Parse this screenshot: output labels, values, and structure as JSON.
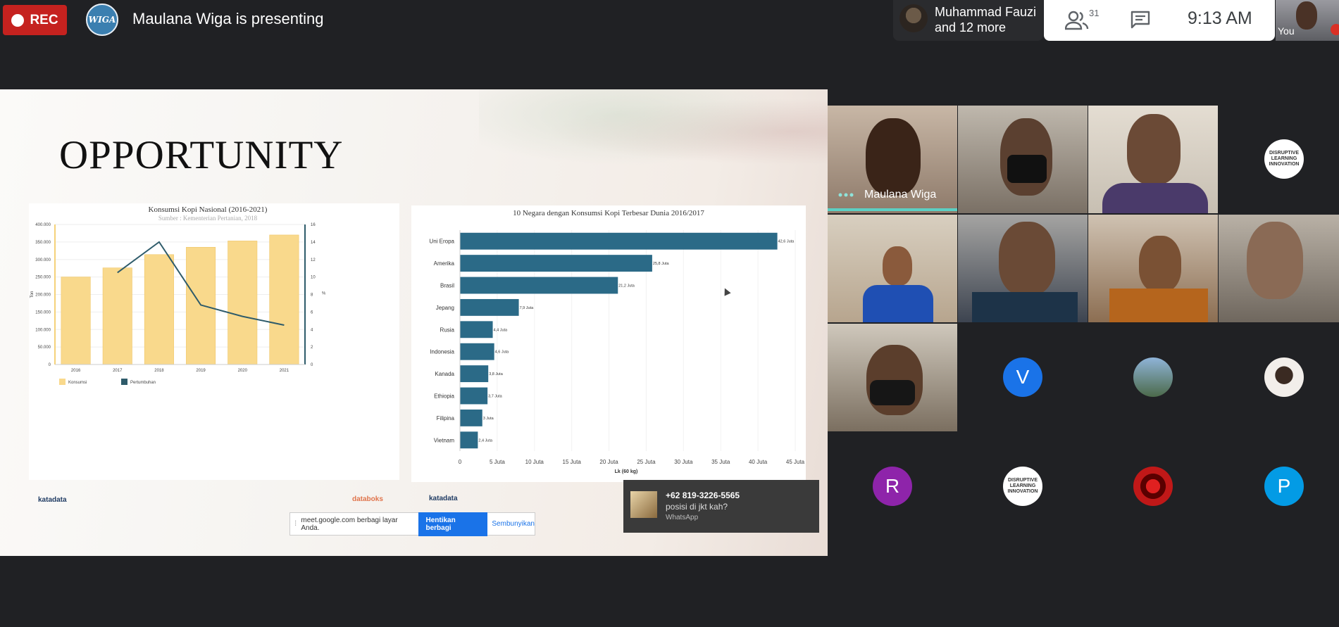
{
  "top_bar": {
    "rec_label": "REC",
    "presenter_avatar_text": "WIGA",
    "presenting_text": "Maulana Wiga is presenting",
    "joined_line1": "Muhammad Fauzi",
    "joined_line2": "and 12 more",
    "participant_count": "31",
    "time": "9:13  AM",
    "self_label": "You"
  },
  "slide": {
    "title": "OPPORTUNITY",
    "logos": [
      "katadata",
      "databoks",
      "katadata"
    ]
  },
  "chart_data": [
    {
      "type": "bar",
      "title": "Konsumsi Kopi Nasional (2016-2021)",
      "subtitle": "Sumber : Kementerian Pertanian, 2018",
      "categories": [
        "2016",
        "2017",
        "2018",
        "2019",
        "2020",
        "2021"
      ],
      "ylabel": "Ton",
      "ylabel_right": "%",
      "ylim": [
        0,
        400000
      ],
      "ylim_right": [
        0,
        16
      ],
      "y_ticks": [
        "0",
        "50.000",
        "100.000",
        "150.000",
        "200.000",
        "250.000",
        "300.000",
        "350.000",
        "400.000"
      ],
      "y_ticks_right": [
        "0",
        "2",
        "4",
        "6",
        "8",
        "10",
        "12",
        "14",
        "16"
      ],
      "series": [
        {
          "name": "Konsumsi",
          "type": "bar",
          "color": "#f9d98c",
          "values": [
            250000,
            276000,
            314000,
            335000,
            353000,
            370000
          ]
        },
        {
          "name": "Pertumbuhan",
          "type": "line",
          "color": "#2e5b6a",
          "values": [
            null,
            10.5,
            14,
            6.8,
            5.5,
            4.5
          ]
        }
      ],
      "legend_position": "bottom-left"
    },
    {
      "type": "bar",
      "orientation": "horizontal",
      "title": "10 Negara dengan Konsumsi Kopi Terbesar Dunia 2016/2017",
      "categories": [
        "Uni Eropa",
        "Amerika",
        "Brasil",
        "Jepang",
        "Rusia",
        "Indonesia",
        "Kanada",
        "Ethiopia",
        "Filipina",
        "Vietnam"
      ],
      "values": [
        42.6,
        25.8,
        21.2,
        7.9,
        4.4,
        4.6,
        3.8,
        3.7,
        3,
        2.4
      ],
      "value_labels": [
        "42,6 Juta",
        "25,8 Juta",
        "21,2 Juta",
        "7,9 Juta",
        "4,4 Juta",
        "4,6 Juta",
        "3,8 Juta",
        "3,7 Juta",
        "3 Juta",
        "2,4 Juta"
      ],
      "x_ticks": [
        "0",
        "5 Juta",
        "10 Juta",
        "15 Juta",
        "20 Juta",
        "25 Juta",
        "30 Juta",
        "35 Juta",
        "40 Juta",
        "45 Juta"
      ],
      "xlim": [
        0,
        45
      ],
      "xlabel": "Lk (60 kg)",
      "color": "#2b6a87"
    }
  ],
  "share_bar": {
    "message": "meet.google.com berbagi layar Anda.",
    "stop_label": "Hentikan berbagi",
    "hide_label": "Sembunyikan"
  },
  "notification": {
    "sender": "+62 819-3226-5565",
    "message": "posisi di jkt kah?",
    "app": "WhatsApp"
  },
  "participants": {
    "speaker_name": "Maulana Wiga",
    "initials": [
      "V",
      "R",
      "P"
    ],
    "colors": {
      "V": "#1a73e8",
      "R": "#8e24aa",
      "P": "#039be5"
    },
    "org_logo_text": "DISRUPTIVE LEARNING INNOVATION"
  }
}
